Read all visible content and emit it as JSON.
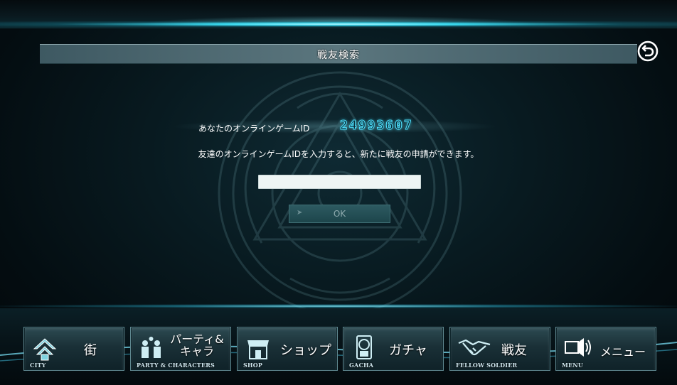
{
  "header": {
    "title": "戦友検索",
    "back_icon": "back-arrow-icon"
  },
  "content": {
    "id_label": "あなたのオンラインゲームID",
    "id_value": "24993607",
    "info": "友達のオンラインゲームIDを入力すると、新たに戦友の申請ができます。",
    "input_value": "",
    "input_placeholder": "",
    "ok_label": "OK"
  },
  "nav": [
    {
      "label": "街",
      "sub": "CITY",
      "icon": "city-icon"
    },
    {
      "label": "パーティ&\nキャラ",
      "sub": "PARTY & CHARACTERS",
      "icon": "party-icon"
    },
    {
      "label": "ショップ",
      "sub": "SHOP",
      "icon": "shop-icon"
    },
    {
      "label": "ガチャ",
      "sub": "GACHA",
      "icon": "gacha-icon"
    },
    {
      "label": "戦友",
      "sub": "FELLOW SOLDIER",
      "icon": "handshake-icon"
    },
    {
      "label": "メニュー",
      "sub": "MENU",
      "icon": "menu-speaker-icon"
    }
  ],
  "colors": {
    "accent": "#4fe2ff",
    "panel": "#5b767e",
    "button": "#1d454b"
  }
}
